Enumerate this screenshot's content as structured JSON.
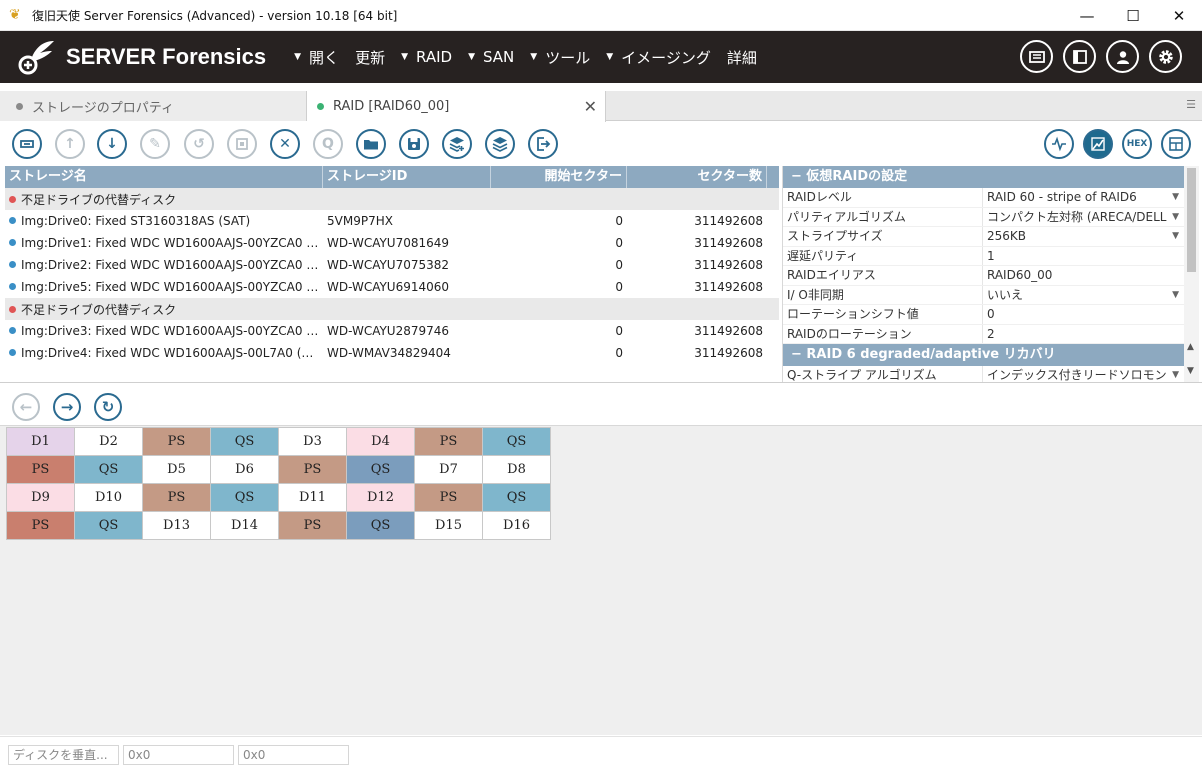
{
  "window": {
    "title": "復旧天使 Server Forensics (Advanced) - version 10.18 [64 bit]",
    "minimize": "—",
    "maximize": "☐",
    "close": "✕"
  },
  "brand": {
    "logo_text": "SERVER Forensics"
  },
  "menu": [
    {
      "label": "開く",
      "has_arrow": true
    },
    {
      "label": "更新",
      "has_arrow": false
    },
    {
      "label": "RAID",
      "has_arrow": true
    },
    {
      "label": "SAN",
      "has_arrow": true
    },
    {
      "label": "ツール",
      "has_arrow": true
    },
    {
      "label": "イメージング",
      "has_arrow": true
    },
    {
      "label": "詳細",
      "has_arrow": false
    }
  ],
  "tabs": [
    {
      "label": "ストレージのプロパティ",
      "dot_color": "#8a8a8a"
    },
    {
      "label": "RAID [RAID60_00]",
      "dot_color": "#3bb273"
    }
  ],
  "toolbar": {
    "left_icons": [
      "raid-config-icon",
      "move-up-icon",
      "move-down-icon",
      "edit-icon",
      "undo-icon",
      "chip-icon",
      "remove-icon",
      "search-q-icon",
      "open-folder-icon",
      "save-icon",
      "stack-add-icon",
      "layers-icon",
      "exit-icon"
    ],
    "right_icons": [
      "waveform-icon",
      "chart-icon",
      "hex-icon",
      "panel-icon"
    ],
    "q_label": "Q",
    "hex_label": "HEX"
  },
  "grid": {
    "columns": [
      "ストレージ名",
      "ストレージID",
      "開始セクター",
      "セクター数"
    ],
    "rows": [
      {
        "group": true,
        "name": "不足ドライブの代替ディスク",
        "dot": "#e05555"
      },
      {
        "name": "Img:Drive0: Fixed ST3160318AS (SAT)",
        "id": "5VM9P7HX",
        "start": "0",
        "count": "311492608",
        "dot": "#3a8fc6"
      },
      {
        "name": "Img:Drive1: Fixed WDC WD1600AAJS-00YZCA0 (...",
        "id": "WD-WCAYU7081649",
        "start": "0",
        "count": "311492608",
        "dot": "#3a8fc6"
      },
      {
        "name": "Img:Drive2: Fixed WDC WD1600AAJS-00YZCA0 (...",
        "id": "WD-WCAYU7075382",
        "start": "0",
        "count": "311492608",
        "dot": "#3a8fc6"
      },
      {
        "name": "Img:Drive5: Fixed WDC WD1600AAJS-00YZCA0 (...",
        "id": "WD-WCAYU6914060",
        "start": "0",
        "count": "311492608",
        "dot": "#3a8fc6"
      },
      {
        "group": true,
        "name": "不足ドライブの代替ディスク",
        "dot": "#e05555"
      },
      {
        "name": "Img:Drive3: Fixed WDC WD1600AAJS-00YZCA0 (...",
        "id": "WD-WCAYU2879746",
        "start": "0",
        "count": "311492608",
        "dot": "#3a8fc6"
      },
      {
        "name": "Img:Drive4: Fixed WDC WD1600AAJS-00L7A0 (SAT)",
        "id": "WD-WMAV34829404",
        "start": "0",
        "count": "311492608",
        "dot": "#3a8fc6"
      }
    ]
  },
  "properties": {
    "section1": "−   仮想RAIDの設定",
    "rows": [
      {
        "name": "RAIDレベル",
        "value": "RAID 60 - stripe of RAID6",
        "dropdown": true
      },
      {
        "name": "パリティアルゴリズム",
        "value": "コンパクト左対称 (ARECA/DELL",
        "dropdown": true
      },
      {
        "name": "ストライプサイズ",
        "value": "256KB",
        "dropdown": true
      },
      {
        "name": "遅延パリティ",
        "value": "1",
        "dropdown": false
      },
      {
        "name": "RAIDエイリアス",
        "value": "RAID60_00",
        "dropdown": false
      },
      {
        "name": "I/ O非同期",
        "value": "いいえ",
        "dropdown": true
      },
      {
        "name": "ローテーションシフト値",
        "value": "0",
        "dropdown": false
      },
      {
        "name": "RAIDのローテーション",
        "value": "2",
        "dropdown": false
      }
    ],
    "section2": "−   RAID 6 degraded/adaptive リカバリ",
    "rows2": [
      {
        "name": "Q-ストライプ アルゴリズム",
        "value": "インデックス付きリードソロモン",
        "dropdown": true
      }
    ]
  },
  "nav": {
    "back": "←",
    "forward": "→",
    "refresh": "↻"
  },
  "raid_layout": {
    "colors": {
      "PS_a": "#c49a85",
      "PS_b": "#c97f6e",
      "QS_a": "#7fb6cc",
      "QS_b": "#7b9dbd",
      "D_lilac": "#e5d3ea",
      "D_pink": "#fbdde5",
      "D_plain": "#ffffff"
    },
    "cells": [
      {
        "t": "D1",
        "c": "D_lilac"
      },
      {
        "t": "D2",
        "c": "D_plain"
      },
      {
        "t": "PS",
        "c": "PS_a"
      },
      {
        "t": "QS",
        "c": "QS_a"
      },
      {
        "t": "D3",
        "c": "D_plain"
      },
      {
        "t": "D4",
        "c": "D_pink"
      },
      {
        "t": "PS",
        "c": "PS_a"
      },
      {
        "t": "QS",
        "c": "QS_a"
      },
      {
        "t": "PS",
        "c": "PS_b"
      },
      {
        "t": "QS",
        "c": "QS_a"
      },
      {
        "t": "D5",
        "c": "D_plain"
      },
      {
        "t": "D6",
        "c": "D_plain"
      },
      {
        "t": "PS",
        "c": "PS_a"
      },
      {
        "t": "QS",
        "c": "QS_b"
      },
      {
        "t": "D7",
        "c": "D_plain"
      },
      {
        "t": "D8",
        "c": "D_plain"
      },
      {
        "t": "D9",
        "c": "D_pink"
      },
      {
        "t": "D10",
        "c": "D_plain"
      },
      {
        "t": "PS",
        "c": "PS_a"
      },
      {
        "t": "QS",
        "c": "QS_a"
      },
      {
        "t": "D11",
        "c": "D_plain"
      },
      {
        "t": "D12",
        "c": "D_pink"
      },
      {
        "t": "PS",
        "c": "PS_a"
      },
      {
        "t": "QS",
        "c": "QS_a"
      },
      {
        "t": "PS",
        "c": "PS_b"
      },
      {
        "t": "QS",
        "c": "QS_a"
      },
      {
        "t": "D13",
        "c": "D_plain"
      },
      {
        "t": "D14",
        "c": "D_plain"
      },
      {
        "t": "PS",
        "c": "PS_a"
      },
      {
        "t": "QS",
        "c": "QS_b"
      },
      {
        "t": "D15",
        "c": "D_plain"
      },
      {
        "t": "D16",
        "c": "D_plain"
      }
    ]
  },
  "statusbar": {
    "field1": "ディスクを垂直...",
    "field2": "0x0",
    "field3": "0x0"
  }
}
